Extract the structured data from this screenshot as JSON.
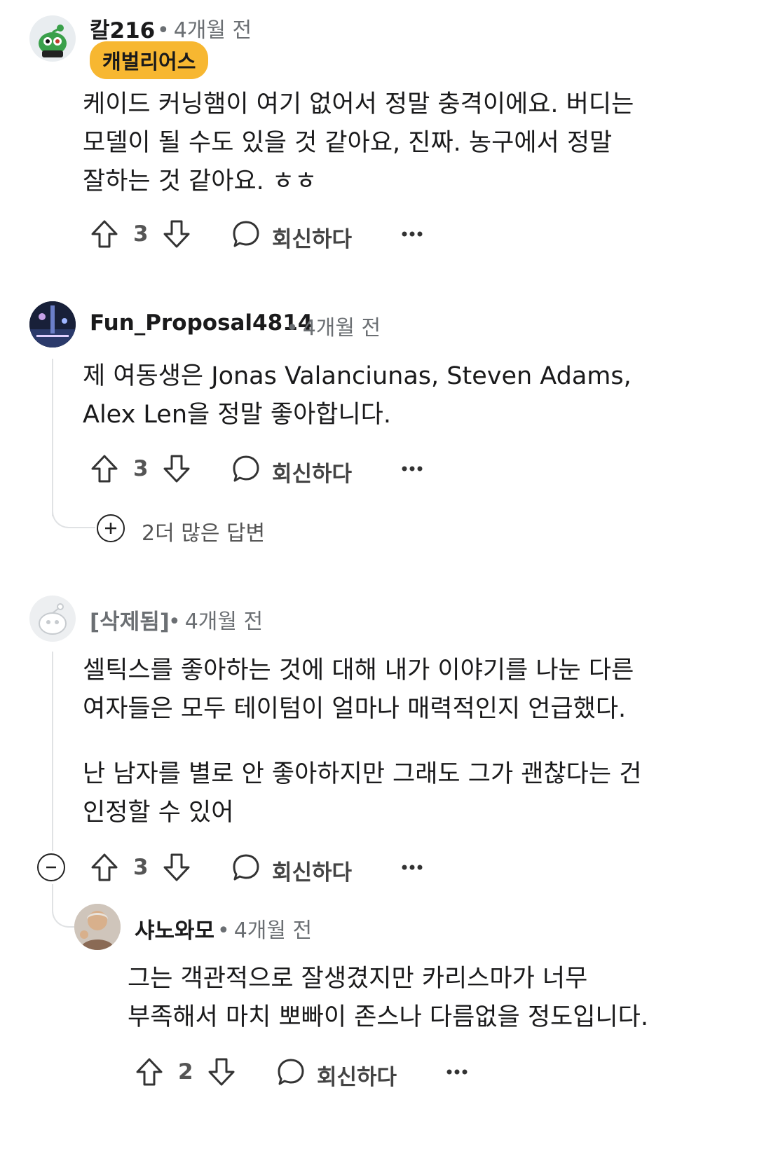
{
  "comments": [
    {
      "author": "칼216",
      "time": "4개월 전",
      "flair": "캐벌리어스",
      "body": "케이드 커닝햄이 여기 없어서 정말 충격이에요. 버디는 모델이 될 수도 있을 것 같아요, 진짜. 농구에서 정말 잘하는 것 같아요. ㅎㅎ",
      "votes": "3",
      "reply_label": "회신하다",
      "avatar_color": "#3aa04a"
    },
    {
      "author": "Fun_Proposal4814",
      "time": "4개월 전",
      "body": "제 여동생은 Jonas Valanciunas, Steven Adams, Alex Len을 정말 좋아합니다.",
      "votes": "3",
      "reply_label": "회신하다",
      "more_replies": "2더 많은 답변"
    },
    {
      "author": "[삭제됨]",
      "time": "4개월 전",
      "body_p1": "셀틱스를 좋아하는 것에 대해 내가 이야기를 나눈 다른 여자들은 모두 테이텀이 얼마나 매력적인지 언급했다.",
      "body_p2": "난 남자를 별로 안 좋아하지만 그래도 그가 괜찮다는 건 인정할 수 있어",
      "votes": "3",
      "reply_label": "회신하다"
    },
    {
      "author": "샤노와모",
      "time": "4개월 전",
      "body": "그는 객관적으로 잘생겼지만 카리스마가 너무 부족해서 마치 뽀빠이 존스나 다름없을 정도입니다.",
      "votes": "2",
      "reply_label": "회신하다"
    }
  ],
  "colors": {
    "flair_bg": "#f7b731",
    "meta_text": "#6b6f73",
    "thread_line": "#e0e2e4"
  },
  "icons": {
    "upvote": "arrow-up-outline-icon",
    "downvote": "arrow-down-outline-icon",
    "reply": "speech-bubble-icon",
    "more": "ellipsis-icon",
    "expand": "plus-circle-icon",
    "collapse": "minus-circle-icon"
  }
}
